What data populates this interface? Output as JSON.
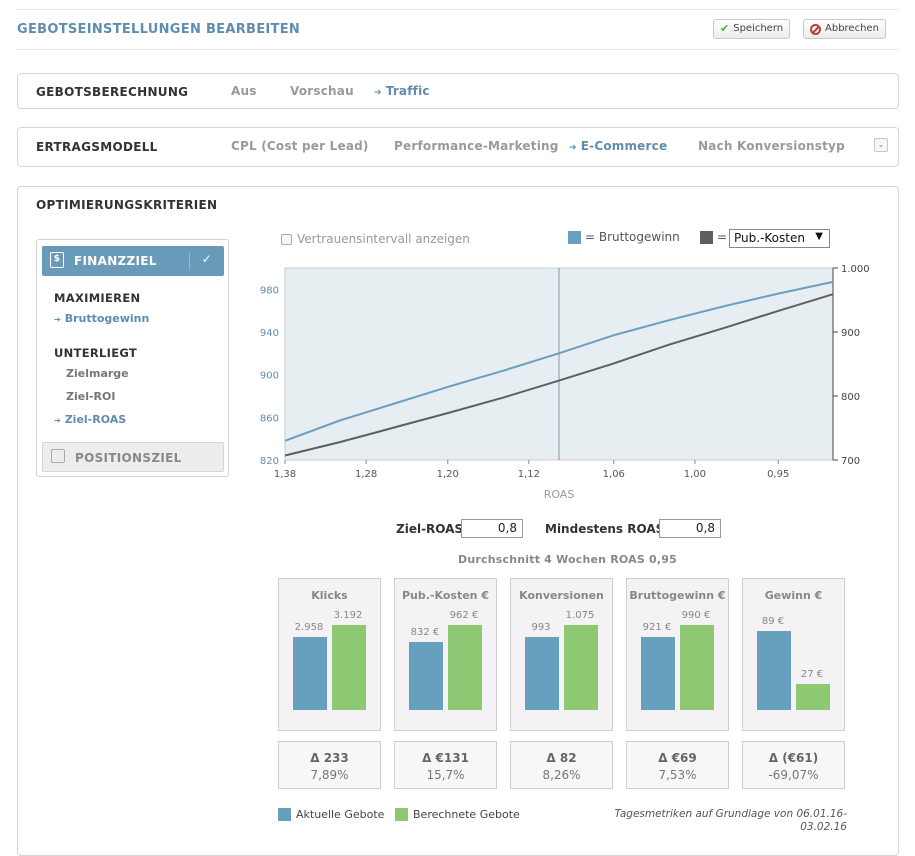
{
  "header": {
    "title": "GEBOTSEINSTELLUNGEN BEARBEITEN",
    "save_label": "Speichern",
    "cancel_label": "Abbrechen"
  },
  "bid_calc": {
    "label": "GEBOTSBERECHNUNG",
    "options": [
      "Aus",
      "Vorschau",
      "Traffic"
    ],
    "active": "Traffic"
  },
  "revenue_model": {
    "label": "ERTRAGSMODELL",
    "options": [
      "CPL (Cost per Lead)",
      "Performance-Marketing",
      "E-Commerce",
      "Nach Konversionstyp"
    ],
    "active": "E-Commerce"
  },
  "optimization": {
    "title": "OPTIMIERUNGSKRITERIEN",
    "finance_goal": "FINANZZIEL",
    "maximize_heading": "MAXIMIEREN",
    "maximize_item": "Bruttogewinn",
    "constraint_heading": "UNTERLIEGT",
    "constraints": [
      "Zielmarge",
      "Ziel-ROI",
      "Ziel-ROAS"
    ],
    "selected_constraint": "Ziel-ROAS",
    "position_goal": "POSITIONSZIEL"
  },
  "chart_controls": {
    "confidence_checkbox_label": "Vertrauensintervall anzeigen",
    "legend_gross_profit": "= Bruttogewinn",
    "legend_secondary_prefix": "=",
    "secondary_metric": "Pub.-Kosten",
    "color_gross_profit": "#6a9fc0",
    "color_secondary": "#5f5f5f"
  },
  "chart_data": {
    "type": "line",
    "xlabel": "ROAS",
    "x_ticks": [
      "1,38",
      "1,28",
      "1,20",
      "1,12",
      "1,06",
      "1,00",
      "0,95"
    ],
    "y_left_ticks": [
      "820",
      "860",
      "900",
      "940",
      "980"
    ],
    "y_left_range": [
      820,
      1000
    ],
    "y_right_ticks": [
      "700",
      "800",
      "900",
      "1.000"
    ],
    "y_right_range": [
      700,
      1000
    ],
    "marker_x_fraction": 0.5,
    "series": [
      {
        "name": "Bruttogewinn",
        "axis": "left",
        "color": "#6a9fc0",
        "x": [
          0,
          0.1,
          0.2,
          0.3,
          0.4,
          0.5,
          0.6,
          0.7,
          0.8,
          0.9,
          1.0
        ],
        "values": [
          838,
          857,
          873,
          889,
          904,
          920,
          937,
          951,
          964,
          976,
          987
        ]
      },
      {
        "name": "Pub.-Kosten",
        "axis": "right",
        "color": "#5f5f5f",
        "x": [
          0,
          0.1,
          0.2,
          0.3,
          0.4,
          0.5,
          0.6,
          0.7,
          0.8,
          0.9,
          1.0
        ],
        "values": [
          707,
          728,
          751,
          774,
          798,
          824,
          851,
          880,
          906,
          933,
          959
        ]
      }
    ]
  },
  "roas": {
    "target_label": "Ziel-ROAS",
    "target_value": "0,8",
    "min_label": "Mindestens ROAS",
    "min_value": "0,8",
    "average_text": "Durchschnitt 4 Wochen ROAS 0,95"
  },
  "metrics": [
    {
      "title": "Klicks",
      "current_label": "2.958",
      "calc_label": "3.192",
      "current": 2958,
      "calc": 3192,
      "delta": "Δ 233",
      "pct": "7,89%"
    },
    {
      "title": "Pub.-Kosten €",
      "current_label": "832 €",
      "calc_label": "962 €",
      "current": 832,
      "calc": 962,
      "delta": "Δ €131",
      "pct": "15,7%"
    },
    {
      "title": "Konversionen",
      "current_label": "993",
      "calc_label": "1.075",
      "current": 993,
      "calc": 1075,
      "delta": "Δ 82",
      "pct": "8,26%"
    },
    {
      "title": "Bruttogewinn €",
      "current_label": "921 €",
      "calc_label": "990 €",
      "current": 921,
      "calc": 990,
      "delta": "Δ €69",
      "pct": "7,53%"
    },
    {
      "title": "Gewinn €",
      "current_label": "89 €",
      "calc_label": "27 €",
      "current": 89,
      "calc": 27,
      "delta": "Δ (€61)",
      "pct": "-69,07%"
    }
  ],
  "legend_bottom": {
    "current_label": "Aktuelle Gebote",
    "calc_label": "Berechnete Gebote",
    "color_current": "#679fbe",
    "color_calc": "#8ec872"
  },
  "footnote": "Tagesmetriken auf Grundlage von 06.01.16-03.02.16"
}
